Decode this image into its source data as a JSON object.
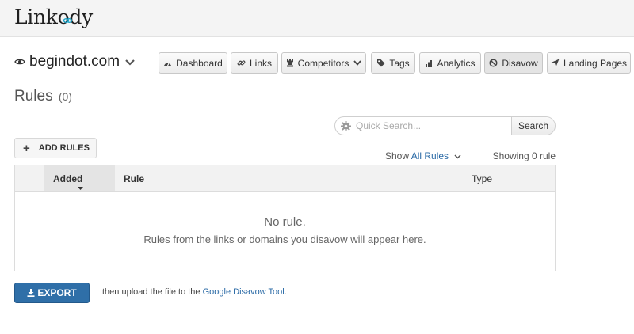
{
  "app": {
    "logo": "Linkody"
  },
  "site": {
    "name": "begindot.com",
    "icon": "eye-icon"
  },
  "nav": [
    {
      "label": "Dashboard",
      "icon": "gauge-icon"
    },
    {
      "label": "Links",
      "icon": "link-icon"
    },
    {
      "label": "Competitors",
      "icon": "chess-icon",
      "has_dropdown": true
    },
    {
      "label": "Tags",
      "icon": "tag-icon"
    },
    {
      "label": "Analytics",
      "icon": "bar-chart-icon"
    },
    {
      "label": "Disavow",
      "icon": "ban-icon",
      "active": true
    },
    {
      "label": "Landing Pages",
      "icon": "paper-plane-icon"
    }
  ],
  "page": {
    "title": "Rules",
    "count": "(0)"
  },
  "search": {
    "placeholder": "Quick Search...",
    "value": "",
    "button_label": "Search"
  },
  "toolbar": {
    "add_label": "ADD RULES"
  },
  "filter": {
    "prefix": "Show",
    "selected": "All Rules",
    "showing": "Showing 0 rule"
  },
  "table": {
    "columns": {
      "added": "Added",
      "rule": "Rule",
      "type": "Type"
    },
    "empty_title": "No rule.",
    "empty_message": "Rules from the links or domains you disavow will appear here."
  },
  "export": {
    "label": "EXPORT",
    "note_prefix": "then upload the file to the",
    "note_link": "Google Disavow Tool",
    "note_suffix": "."
  },
  "colors": {
    "primary": "#2f6fa8",
    "link": "#2a6aa6",
    "topbar": "#f4f4f4"
  }
}
